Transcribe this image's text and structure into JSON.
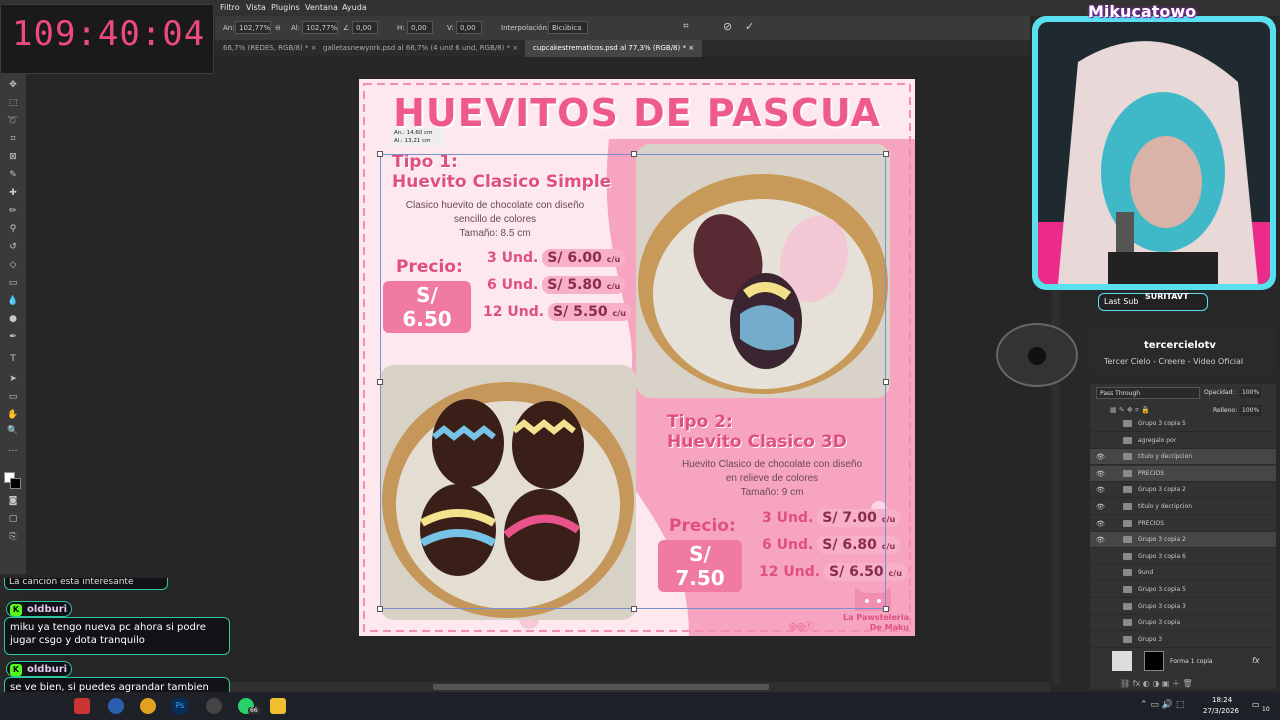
{
  "timer": "109:40:04",
  "menu": [
    "Filtro",
    "Vista",
    "Plugins",
    "Ventana",
    "Ayuda"
  ],
  "options": {
    "an_label": "An:",
    "an_value": "102,77%",
    "al_label": "Al:",
    "al_value": "102,77%",
    "angle_value": "0,00",
    "h_label": "H:",
    "h_value": "0,00",
    "v_label": "V:",
    "v_value": "0,00",
    "interp_label": "Interpolación:",
    "interp_value": "Bicúbica"
  },
  "tabs": [
    {
      "label": "66,7% (REDES, RGB/8) *"
    },
    {
      "label": "galletasnewyork.psd al 66,7% (4 und   6 und, RGB/8) *"
    },
    {
      "label": "cupcakestrematicos.psd al 77,3% (RGB/8) *"
    }
  ],
  "doc": {
    "title": "HUEVITOS DE PASCUA",
    "tipo1": {
      "line1": "Tipo 1:",
      "line2": "Huevito Clasico Simple",
      "desc": [
        "Clasico huevito de chocolate con diseño",
        "sencillo de colores",
        "Tamaño: 8.5 cm"
      ],
      "precio_label": "Precio:",
      "precio": "S/ 6.50",
      "rows": [
        {
          "qty": "3 Und.",
          "price": "S/ 6.00",
          "unit": "c/u"
        },
        {
          "qty": "6 Und.",
          "price": "S/ 5.80",
          "unit": "c/u"
        },
        {
          "qty": "12 Und.",
          "price": "S/ 5.50",
          "unit": "c/u"
        }
      ]
    },
    "tipo2": {
      "line1": "Tipo 2:",
      "line2": "Huevito Clasico 3D",
      "desc": [
        "Huevito Clasico de chocolate con diseño",
        "en relieve de colores",
        "Tamaño: 9 cm"
      ],
      "precio_label": "Precio:",
      "precio": "S/ 7.50",
      "rows": [
        {
          "qty": "3 Und.",
          "price": "S/ 7.00",
          "unit": "c/u"
        },
        {
          "qty": "6 Und.",
          "price": "S/ 6.80",
          "unit": "c/u"
        },
        {
          "qty": "12 Und.",
          "price": "S/ 6.50",
          "unit": "c/u"
        }
      ]
    },
    "brand": [
      "La Pawsteleria",
      "De Maku"
    ],
    "dim_an": "An.:   14,60 cm",
    "dim_al": "Al.:   13,21 cm"
  },
  "stream": {
    "channel": "Mikucatowo",
    "last_sub_label": "Last Sub",
    "last_sub_name": "SURITAVT"
  },
  "song": {
    "artist": "tercercielotv",
    "title": "Tercer Cielo - Creere - Video Oficial"
  },
  "layers_panel": {
    "blend": "Pass Through",
    "opacity_label": "Opacidad:",
    "opacity": "100%",
    "fill_label": "Relleno:",
    "fill": "100%",
    "layers": [
      {
        "name": "Grupo 3 copia 5",
        "visible": false
      },
      {
        "name": "agregalo por",
        "visible": false
      },
      {
        "name": "titulo y decripcion",
        "visible": true
      },
      {
        "name": "PRECIOS",
        "visible": true
      },
      {
        "name": "Grupo 3 copia 2",
        "visible": true
      },
      {
        "name": "titulo y decripcion",
        "visible": true
      },
      {
        "name": "PRECIOS",
        "visible": true
      },
      {
        "name": "Grupo 3 copia 2",
        "visible": true
      },
      {
        "name": "Grupo 3 copia 6",
        "visible": false
      },
      {
        "name": "9und",
        "visible": false
      },
      {
        "name": "Grupo 3 copia 5",
        "visible": false
      },
      {
        "name": "Grupo 3 copia 3",
        "visible": false
      },
      {
        "name": "Grupo 3 copia",
        "visible": false
      },
      {
        "name": "Grupo 3",
        "visible": false
      }
    ],
    "bottom_layer": "Forma 1 copia",
    "fx": "fx"
  },
  "chat": {
    "partial": "La canción esta interesante",
    "messages": [
      {
        "user": "oldburi",
        "text": "miku ya tengo nueva pc ahora si podre jugar csgo y dota tranquilo"
      },
      {
        "user": "oldburi",
        "text": "se ve bien, si puedes agrandar tambien"
      }
    ]
  },
  "taskbar": {
    "time": "18:24",
    "date": "27/3/2026",
    "badge": "66",
    "notif": "10"
  },
  "colors": {
    "accent_pink": "#ee5b8a",
    "cam_border": "#58e0ee",
    "cam_inner": "#ec2a8a",
    "chat_border": "#2ec6a0"
  }
}
